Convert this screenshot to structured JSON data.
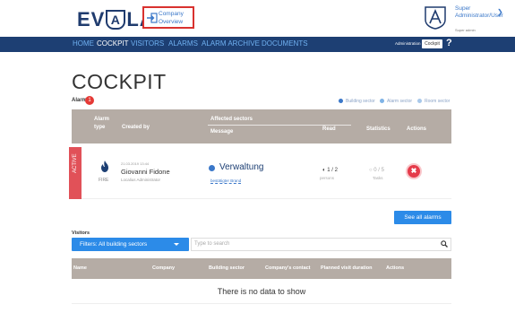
{
  "header": {
    "logo_left": "EV",
    "logo_mid": "A",
    "logo_right": "LARM",
    "logo_mark": "®",
    "company_line1": "Company",
    "company_line2": "Overview",
    "user_line1": "Super",
    "user_line2": "Administrator/User",
    "user_role": "Super admin"
  },
  "nav": {
    "items": [
      "HOME",
      "COCKPIT",
      "VISITORS",
      "ALARMS",
      "ALARM ARCHIVE",
      "DOCUMENTS"
    ],
    "active": "COCKPIT",
    "admin_label": "Administration",
    "cockpit_button": "Cockpit",
    "help": "?"
  },
  "page": {
    "title": "COCKPIT"
  },
  "alarms": {
    "label": "Alarms",
    "count": "1",
    "legend": [
      {
        "label": "Building sector",
        "color": "#3b78c9"
      },
      {
        "label": "Alarm sector",
        "color": "#7fb3e6"
      },
      {
        "label": "Room sector",
        "color": "#a8c8ea"
      }
    ],
    "columns": {
      "alarm_type": "Alarm",
      "alarm_type_2": "type",
      "created_by": "Created by",
      "affected_sectors": "Affected sectors",
      "message": "Message",
      "read": "Read",
      "statistics": "Statistics",
      "actions": "Actions"
    },
    "row": {
      "status": "ACTIVE",
      "type_label": "FIRE",
      "date": "21.03.2019 13:44",
      "name": "Giovanni Fidone",
      "role": "Localius Administrator",
      "sector": "Verwaltung",
      "message": "bestätigter Brand",
      "read_value": "1 / 2",
      "read_sub": "persons",
      "stat_value": "0 / 5",
      "stat_sub": "Tasks"
    },
    "see_all": "See all alarms"
  },
  "visitors": {
    "label": "Visitors",
    "filter": "Filters: All building sectors",
    "search_placeholder": "Type to search",
    "columns": [
      "Name",
      "Company",
      "Building sector",
      "Company's contact",
      "Planned visit duration",
      "Actions"
    ],
    "empty": "There is no data to show"
  },
  "colors": {
    "nav_bg": "#1d3f73",
    "accent": "#2c8be8",
    "alert": "#e53b4a",
    "table_head": "#b5aca5"
  }
}
